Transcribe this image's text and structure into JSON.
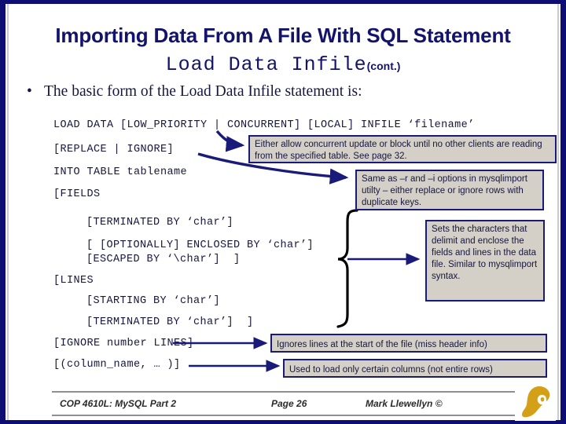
{
  "slide": {
    "title": "Importing Data From A File With SQL Statement",
    "subtitle_mono": "Load Data Infile",
    "subtitle_cont": "(cont.)",
    "bullet": "The basic form of the Load Data Infile statement is:",
    "accent_navy": "#13136b",
    "callout_fill": "#d4d0c8",
    "logo_gold": "#d4a017"
  },
  "syntax": [
    {
      "id": "line1",
      "text": "LOAD DATA [LOW_PRIORITY | CONCURRENT] [LOCAL] INFILE ‘filename’"
    },
    {
      "id": "line2",
      "text": "[REPLACE | IGNORE]"
    },
    {
      "id": "line3",
      "text": "INTO TABLE tablename"
    },
    {
      "id": "line4",
      "text": "[FIELDS"
    },
    {
      "id": "line5",
      "text": "[TERMINATED BY ‘char’]"
    },
    {
      "id": "line6",
      "text": "[ [OPTIONALLY] ENCLOSED BY ‘char’]"
    },
    {
      "id": "line7",
      "text": "[ESCAPED BY ‘\\char’]  ]"
    },
    {
      "id": "line8",
      "text": "[LINES"
    },
    {
      "id": "line9",
      "text": "[STARTING BY ‘char’]"
    },
    {
      "id": "line10",
      "text": "[TERMINATED BY ‘char’]  ]"
    },
    {
      "id": "line11",
      "text": "[IGNORE number LINES]"
    },
    {
      "id": "line12",
      "text": "[(column_name, … )]"
    }
  ],
  "callouts": [
    {
      "id": "callout1",
      "text": "Either allow concurrent update or block until no other clients are reading from the specified table.  See page 32."
    },
    {
      "id": "callout2",
      "text": "Same as –r and –i options in mysqlimport utilty – either replace or ignore rows with duplicate keys."
    },
    {
      "id": "callout3",
      "text": "Sets the characters that delimit and enclose the fields and lines in the data file. Similar to mysqlimport syntax."
    },
    {
      "id": "callout4",
      "text": "Ignores lines at the start of the file (miss header info)"
    },
    {
      "id": "callout5",
      "text": "Used to load only certain columns (not entire rows)"
    }
  ],
  "footer": {
    "course": "COP 4610L: MySQL Part 2",
    "page": "Page 26",
    "author": "Mark Llewellyn ©",
    "logo": "ucf-pegasus-logo"
  }
}
